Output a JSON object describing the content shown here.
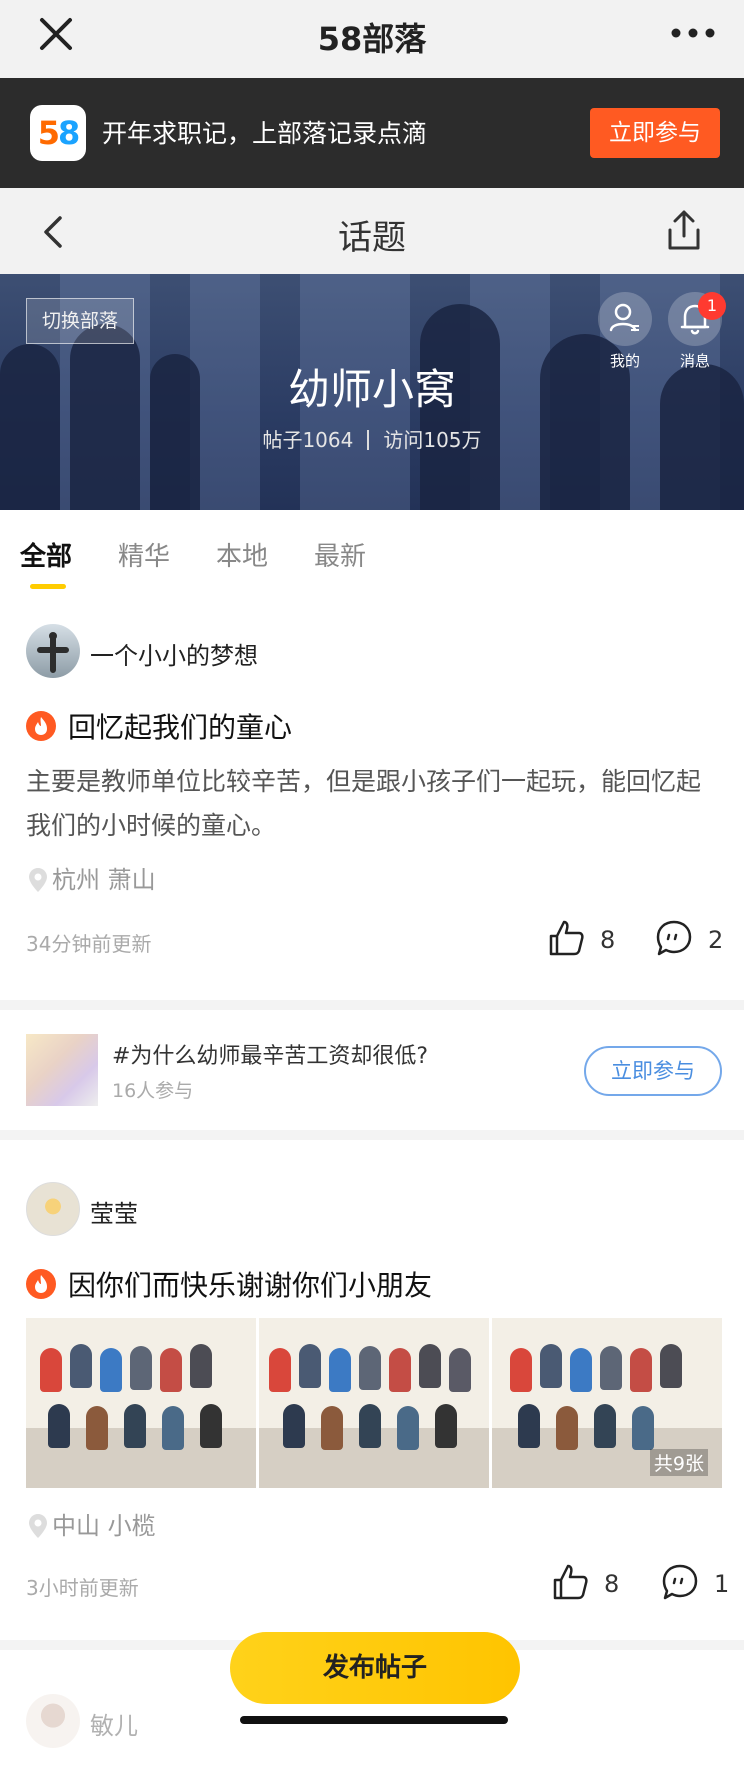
{
  "top_bar": {
    "title": "58部落",
    "close_icon": "close-icon",
    "more_icon": "more-icon"
  },
  "banner": {
    "logo": "58",
    "text": "开年求职记，上部落记录点滴",
    "button_label": "立即参与"
  },
  "page_header": {
    "title": "话题",
    "back_icon": "back-icon",
    "share_icon": "share-icon"
  },
  "hero": {
    "switch_label": "切换部落",
    "tribe_name": "幼师小窝",
    "posts_stat": "帖子1064",
    "visits_stat": "访问105万",
    "me_label": "我的",
    "messages_label": "消息",
    "message_badge": "1"
  },
  "tabs": [
    {
      "label": "全部",
      "active": true
    },
    {
      "label": "精华",
      "active": false
    },
    {
      "label": "本地",
      "active": false
    },
    {
      "label": "最新",
      "active": false
    }
  ],
  "posts": [
    {
      "author": "一个小小的梦想",
      "title": "回忆起我们的童心",
      "body": "主要是教师单位比较辛苦，但是跟小孩子们一起玩，能回忆起我们的小时候的童心。",
      "location": "杭州 萧山",
      "time": "34分钟前更新",
      "likes": "8",
      "comments": "2"
    },
    {
      "author": "莹莹",
      "title": "因你们而快乐谢谢你们小朋友",
      "photo_count_label": "共9张",
      "location": "中山 小榄",
      "time": "3小时前更新",
      "likes": "8",
      "comments": "1"
    },
    {
      "author": "敏儿"
    }
  ],
  "topic": {
    "title": "#为什么幼师最辛苦工资却很低?",
    "participants": "16人参与",
    "button_label": "立即参与"
  },
  "fab_label": "发布帖子",
  "colors": {
    "accent_orange": "#ff5a22",
    "accent_yellow": "#ffcc00",
    "link_blue": "#4a8ee0"
  }
}
